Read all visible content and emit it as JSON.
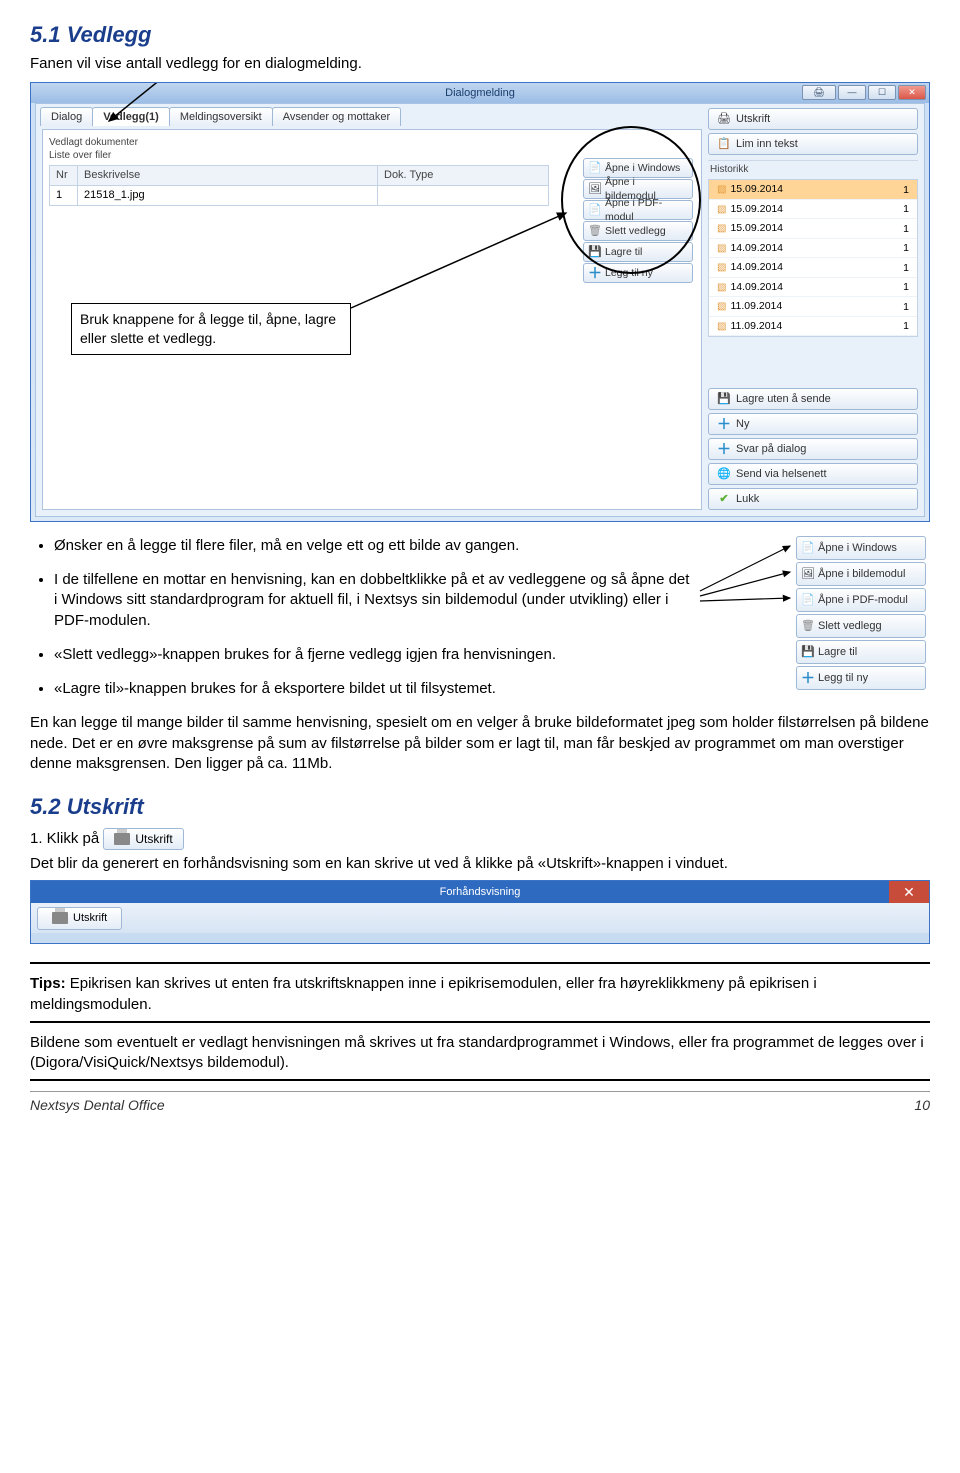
{
  "section51": {
    "heading": "5.1  Vedlegg",
    "intro": "Fanen vil vise antall vedlegg for en dialogmelding.",
    "callout": "Bruk knappene for å legge til, åpne, lagre eller slette et vedlegg."
  },
  "screenshot": {
    "window_title": "Dialogmelding",
    "tabs": [
      "Dialog",
      "Vedlegg(1)",
      "Meldingsoversikt",
      "Avsender og mottaker"
    ],
    "vedlagt_label": "Vedlagt dokumenter",
    "liste_label": "Liste over filer",
    "table": {
      "headers": [
        "Nr",
        "Beskrivelse",
        "Dok. Type"
      ],
      "row": [
        "1",
        "21518_1.jpg",
        ""
      ]
    },
    "vedlegg_buttons": [
      "Åpne i Windows",
      "Åpne i bildemodul",
      "Åpne i PDF-modul",
      "Slett vedlegg",
      "Lagre til",
      "Legg til ny"
    ],
    "right_buttons_top": [
      {
        "icon": "printer",
        "label": "Utskrift"
      },
      {
        "icon": "clip",
        "label": "Lim inn tekst"
      }
    ],
    "historikk_label": "Historikk",
    "historikk": [
      {
        "date": "15.09.2014",
        "n": "1",
        "sel": true
      },
      {
        "date": "15.09.2014",
        "n": "1"
      },
      {
        "date": "15.09.2014",
        "n": "1"
      },
      {
        "date": "14.09.2014",
        "n": "1"
      },
      {
        "date": "14.09.2014",
        "n": "1"
      },
      {
        "date": "14.09.2014",
        "n": "1"
      },
      {
        "date": "11.09.2014",
        "n": "1"
      },
      {
        "date": "11.09.2014",
        "n": "1"
      }
    ],
    "right_buttons_bottom": [
      {
        "icon": "save",
        "label": "Lagre uten å sende"
      },
      {
        "icon": "plus",
        "label": "Ny"
      },
      {
        "icon": "plus",
        "label": "Svar på dialog"
      },
      {
        "icon": "net",
        "label": "Send via helsenett"
      },
      {
        "icon": "check",
        "label": "Lukk"
      }
    ]
  },
  "bullets": [
    "Ønsker en å legge til flere filer, må en velge ett og ett bilde av gangen.",
    "I de tilfellene en mottar en henvisning, kan en dobbeltklikke på et av vedleggene og så åpne det i Windows sitt standardprogram for aktuell fil, i Nextsys sin bildemodul (under utvikling) eller i PDF-modulen.",
    "«Slett vedlegg»-knappen brukes for å fjerne vedlegg igjen fra henvisningen.",
    "«Lagre til»-knappen brukes for å eksportere bildet ut til filsystemet."
  ],
  "side_buttons": [
    "Åpne i Windows",
    "Åpne i bildemodul",
    "Åpne i PDF-modul",
    "Slett vedlegg",
    "Lagre til",
    "Legg til ny"
  ],
  "para_after_bullets": "En kan legge til mange bilder til samme henvisning, spesielt om en velger å bruke bildeformatet jpeg som holder filstørrelsen på bildene nede. Det er en øvre maksgrense på sum av filstørrelse på bilder som er lagt til, man får beskjed av programmet om man overstiger denne maksgrensen. Den ligger på ca. 11Mb.",
  "section52": {
    "heading": "5.2  Utskrift",
    "step1_prefix": "1. Klikk på",
    "inline_btn": "Utskrift",
    "after": "Det blir da generert en forhåndsvisning som en kan skrive ut ved å klikke på «Utskrift»-knappen i vinduet."
  },
  "preview": {
    "title": "Forhåndsvisning",
    "utskrift": "Utskrift"
  },
  "tips": "Tips: Epikrisen kan skrives ut enten fra utskriftsknappen inne i epikrisemodulen, eller fra høyreklikkmeny på epikrisen i meldingsmodulen.",
  "tips2": "Bildene som eventuelt er vedlagt henvisningen må skrives ut fra standardprogrammet i Windows, eller fra programmet de legges over i (Digora/VisiQuick/Nextsys bildemodul).",
  "footer": {
    "left": "Nextsys Dental Office",
    "right": "10"
  }
}
